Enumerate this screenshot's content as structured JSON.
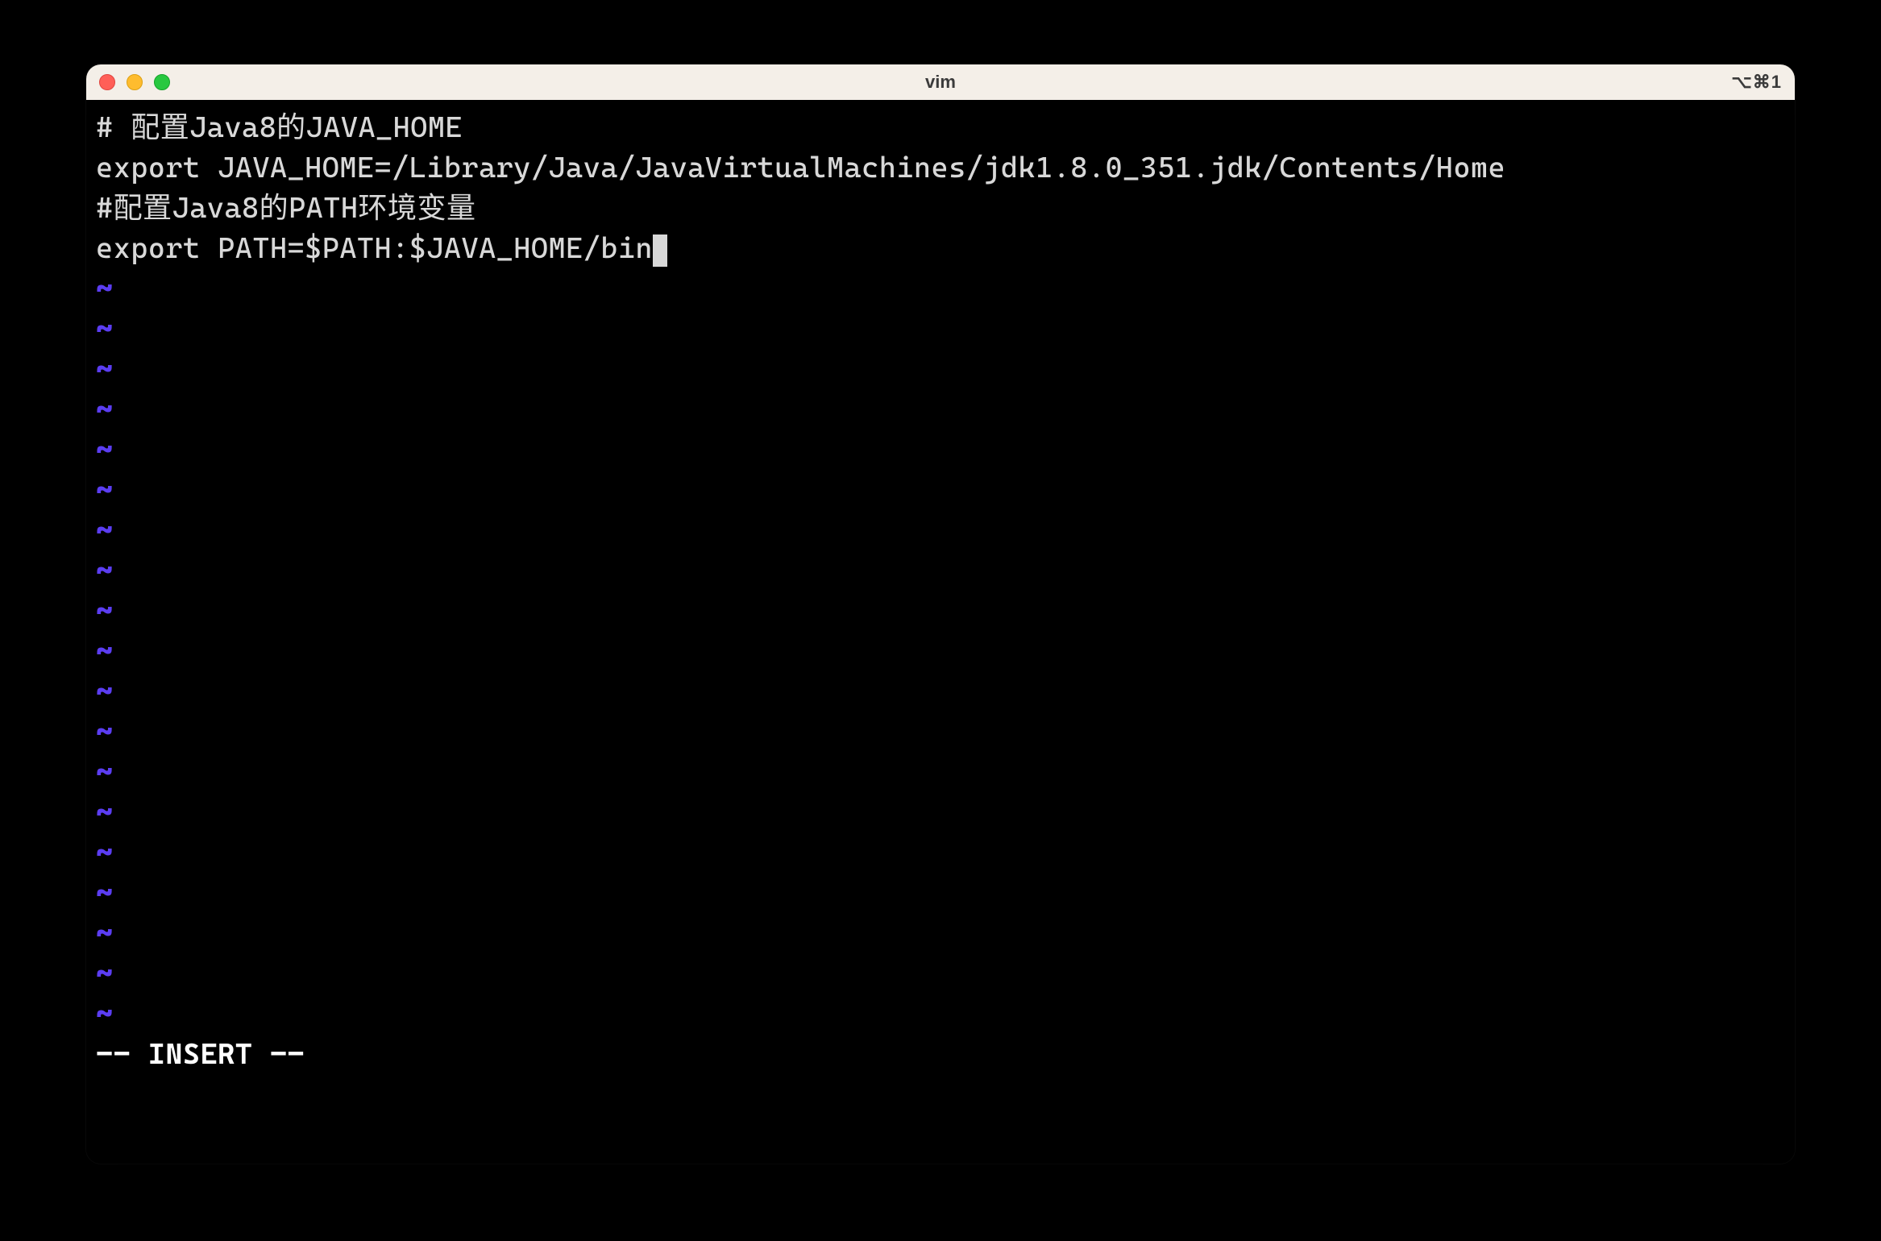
{
  "window": {
    "title": "vim",
    "shortcut": "⌥⌘1"
  },
  "editor": {
    "lines": [
      "# 配置Java8的JAVA_HOME",
      "export JAVA_HOME=/Library/Java/JavaVirtualMachines/jdk1.8.0_351.jdk/Contents/Home",
      "#配置Java8的PATH环境变量",
      "export PATH=$PATH:$JAVA_HOME/bin"
    ],
    "cursor_line_index": 3,
    "empty_line_glyph": "~",
    "empty_line_count": 19,
    "mode_line": "-- INSERT --"
  },
  "colors": {
    "bg": "#000000",
    "fg": "#d8d8d8",
    "tilde": "#5b3df2",
    "titlebar_bg": "#f4efe8",
    "close": "#ff5f57",
    "min": "#febc2e",
    "max": "#28c840"
  }
}
